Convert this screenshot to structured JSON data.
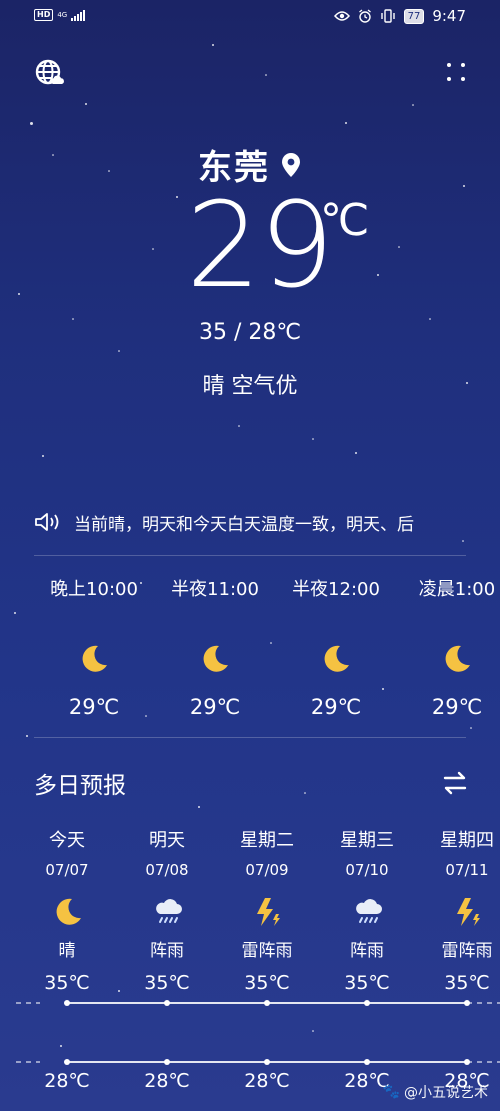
{
  "status_bar": {
    "hd": "HD",
    "network": "4G",
    "battery": "77",
    "time": "9:47"
  },
  "location": {
    "city": "东莞"
  },
  "current": {
    "temp": "29",
    "unit": "℃",
    "range": "35 / 28℃",
    "condition": "晴  空气优"
  },
  "announcement": "当前晴，明天和今天白天温度一致，明天、后",
  "hourly": [
    {
      "time": "晚上10:00",
      "icon": "moon-icon",
      "temp": "29℃"
    },
    {
      "time": "半夜11:00",
      "icon": "moon-icon",
      "temp": "29℃"
    },
    {
      "time": "半夜12:00",
      "icon": "moon-icon",
      "temp": "29℃"
    },
    {
      "time": "凌晨1:00",
      "icon": "moon-icon",
      "temp": "29℃"
    }
  ],
  "forecast_title": "多日预报",
  "daily": [
    {
      "day": "今天",
      "date": "07/07",
      "icon": "moon-icon",
      "condition": "晴",
      "high": "35℃",
      "low": "28℃"
    },
    {
      "day": "明天",
      "date": "07/08",
      "icon": "rain-cloud-icon",
      "condition": "阵雨",
      "high": "35℃",
      "low": "28℃"
    },
    {
      "day": "星期二",
      "date": "07/09",
      "icon": "thunder-icon",
      "condition": "雷阵雨",
      "high": "35℃",
      "low": "28℃"
    },
    {
      "day": "星期三",
      "date": "07/10",
      "icon": "rain-cloud-icon",
      "condition": "阵雨",
      "high": "35℃",
      "low": "28℃"
    },
    {
      "day": "星期四",
      "date": "07/11",
      "icon": "thunder-icon",
      "condition": "雷阵雨",
      "high": "35℃",
      "low": "28℃"
    }
  ],
  "watermark": "@小五说艺术",
  "colors": {
    "background": "#1f2f7d",
    "moon": "#f5c242",
    "bolt": "#f5c242"
  }
}
